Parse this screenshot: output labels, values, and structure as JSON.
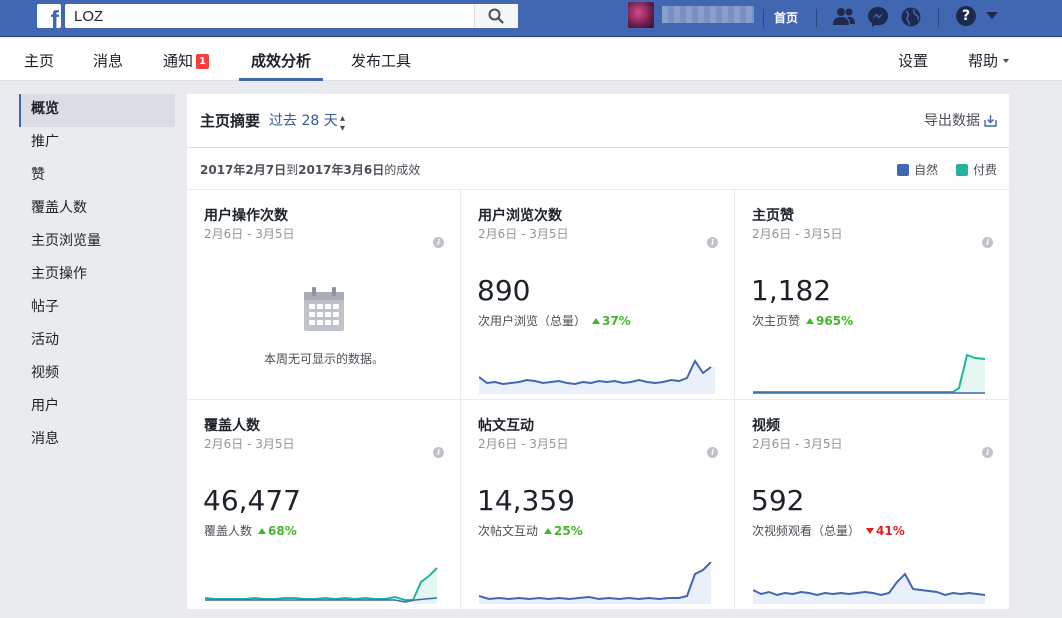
{
  "topbar": {
    "search_value": "LOZ",
    "home_label": "首页",
    "help_label": "?"
  },
  "pagenav": {
    "tabs": [
      {
        "label": "主页"
      },
      {
        "label": "消息"
      },
      {
        "label": "通知",
        "badge": "1"
      },
      {
        "label": "成效分析"
      },
      {
        "label": "发布工具"
      }
    ],
    "right": [
      {
        "label": "设置"
      },
      {
        "label": "帮助"
      }
    ]
  },
  "sidebar": {
    "items": [
      {
        "label": "概览"
      },
      {
        "label": "推广"
      },
      {
        "label": "赞"
      },
      {
        "label": "覆盖人数"
      },
      {
        "label": "主页浏览量"
      },
      {
        "label": "主页操作"
      },
      {
        "label": "帖子"
      },
      {
        "label": "活动"
      },
      {
        "label": "视频"
      },
      {
        "label": "用户"
      },
      {
        "label": "消息"
      }
    ]
  },
  "summary": {
    "title": "主页摘要",
    "range": "过去 28 天",
    "export_label": "导出数据",
    "date_range_prefix": "2017年2月7日",
    "date_range_mid": "到",
    "date_range_end": "2017年3月6日",
    "date_range_suffix": "的成效",
    "legend": [
      {
        "label": "自然",
        "color": "#4267b2"
      },
      {
        "label": "付费",
        "color": "#20b59c"
      }
    ]
  },
  "cards": [
    {
      "title": "用户操作次数",
      "range": "2月6日 - 3月5日",
      "empty_text": "本周无可显示的数据。"
    },
    {
      "title": "用户浏览次数",
      "range": "2月6日 - 3月5日",
      "value": "890",
      "desc": "次用户浏览（总量）",
      "change": "37%",
      "direction": "up"
    },
    {
      "title": "主页赞",
      "range": "2月6日 - 3月5日",
      "value": "1,182",
      "desc": "次主页赞",
      "change": "965%",
      "direction": "up"
    },
    {
      "title": "覆盖人数",
      "range": "2月6日 - 3月5日",
      "value": "46,477",
      "desc": "覆盖人数",
      "change": "68%",
      "direction": "up"
    },
    {
      "title": "帖文互动",
      "range": "2月6日 - 3月5日",
      "value": "14,359",
      "desc": "次帖文互动",
      "change": "25%",
      "direction": "up"
    },
    {
      "title": "视频",
      "range": "2月6日 - 3月5日",
      "value": "592",
      "desc": "次视频观看（总量）",
      "change": "41%",
      "direction": "down"
    }
  ]
}
